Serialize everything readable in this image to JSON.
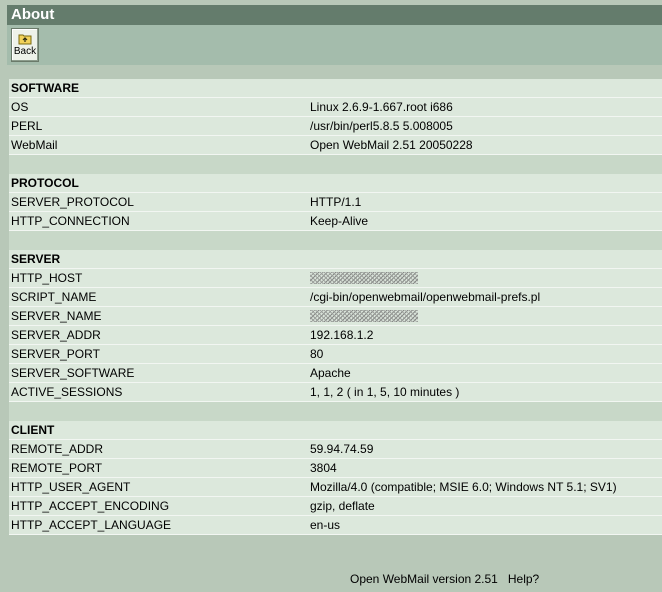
{
  "title": "About",
  "toolbar": {
    "back_label": "Back",
    "back_icon": "back-folder-icon"
  },
  "sections": [
    {
      "id": "software",
      "heading": "SOFTWARE",
      "rows": [
        {
          "key": "OS",
          "value": "Linux 2.6.9-1.667.root i686"
        },
        {
          "key": "PERL",
          "value": "/usr/bin/perl5.8.5 5.008005"
        },
        {
          "key": "WebMail",
          "value": "Open WebMail 2.51 20050228"
        }
      ]
    },
    {
      "id": "protocol",
      "heading": "PROTOCOL",
      "rows": [
        {
          "key": "SERVER_PROTOCOL",
          "value": "HTTP/1.1"
        },
        {
          "key": "HTTP_CONNECTION",
          "value": "Keep-Alive"
        }
      ]
    },
    {
      "id": "server",
      "heading": "SERVER",
      "rows": [
        {
          "key": "HTTP_HOST",
          "value": "",
          "redacted": true
        },
        {
          "key": "SCRIPT_NAME",
          "value": "/cgi-bin/openwebmail/openwebmail-prefs.pl"
        },
        {
          "key": "SERVER_NAME",
          "value": "",
          "redacted": true
        },
        {
          "key": "SERVER_ADDR",
          "value": "192.168.1.2"
        },
        {
          "key": "SERVER_PORT",
          "value": "80"
        },
        {
          "key": "SERVER_SOFTWARE",
          "value": "Apache"
        },
        {
          "key": "ACTIVE_SESSIONS",
          "value": "1, 1, 2 ( in 1, 5, 10 minutes )"
        }
      ]
    },
    {
      "id": "client",
      "heading": "CLIENT",
      "rows": [
        {
          "key": "REMOTE_ADDR",
          "value": "59.94.74.59"
        },
        {
          "key": "REMOTE_PORT",
          "value": "3804"
        },
        {
          "key": "HTTP_USER_AGENT",
          "value": "Mozilla/4.0 (compatible; MSIE 6.0; Windows NT 5.1; SV1)"
        },
        {
          "key": "HTTP_ACCEPT_ENCODING",
          "value": "gzip, deflate"
        },
        {
          "key": "HTTP_ACCEPT_LANGUAGE",
          "value": "en-us"
        }
      ]
    }
  ],
  "footer": {
    "version": "Open WebMail version 2.51",
    "help": "Help?"
  },
  "colors": {
    "title_bar": "#647c6c",
    "toolbar": "#a4bcac",
    "row": "#dce8dc",
    "background": "#b8c8b8"
  }
}
